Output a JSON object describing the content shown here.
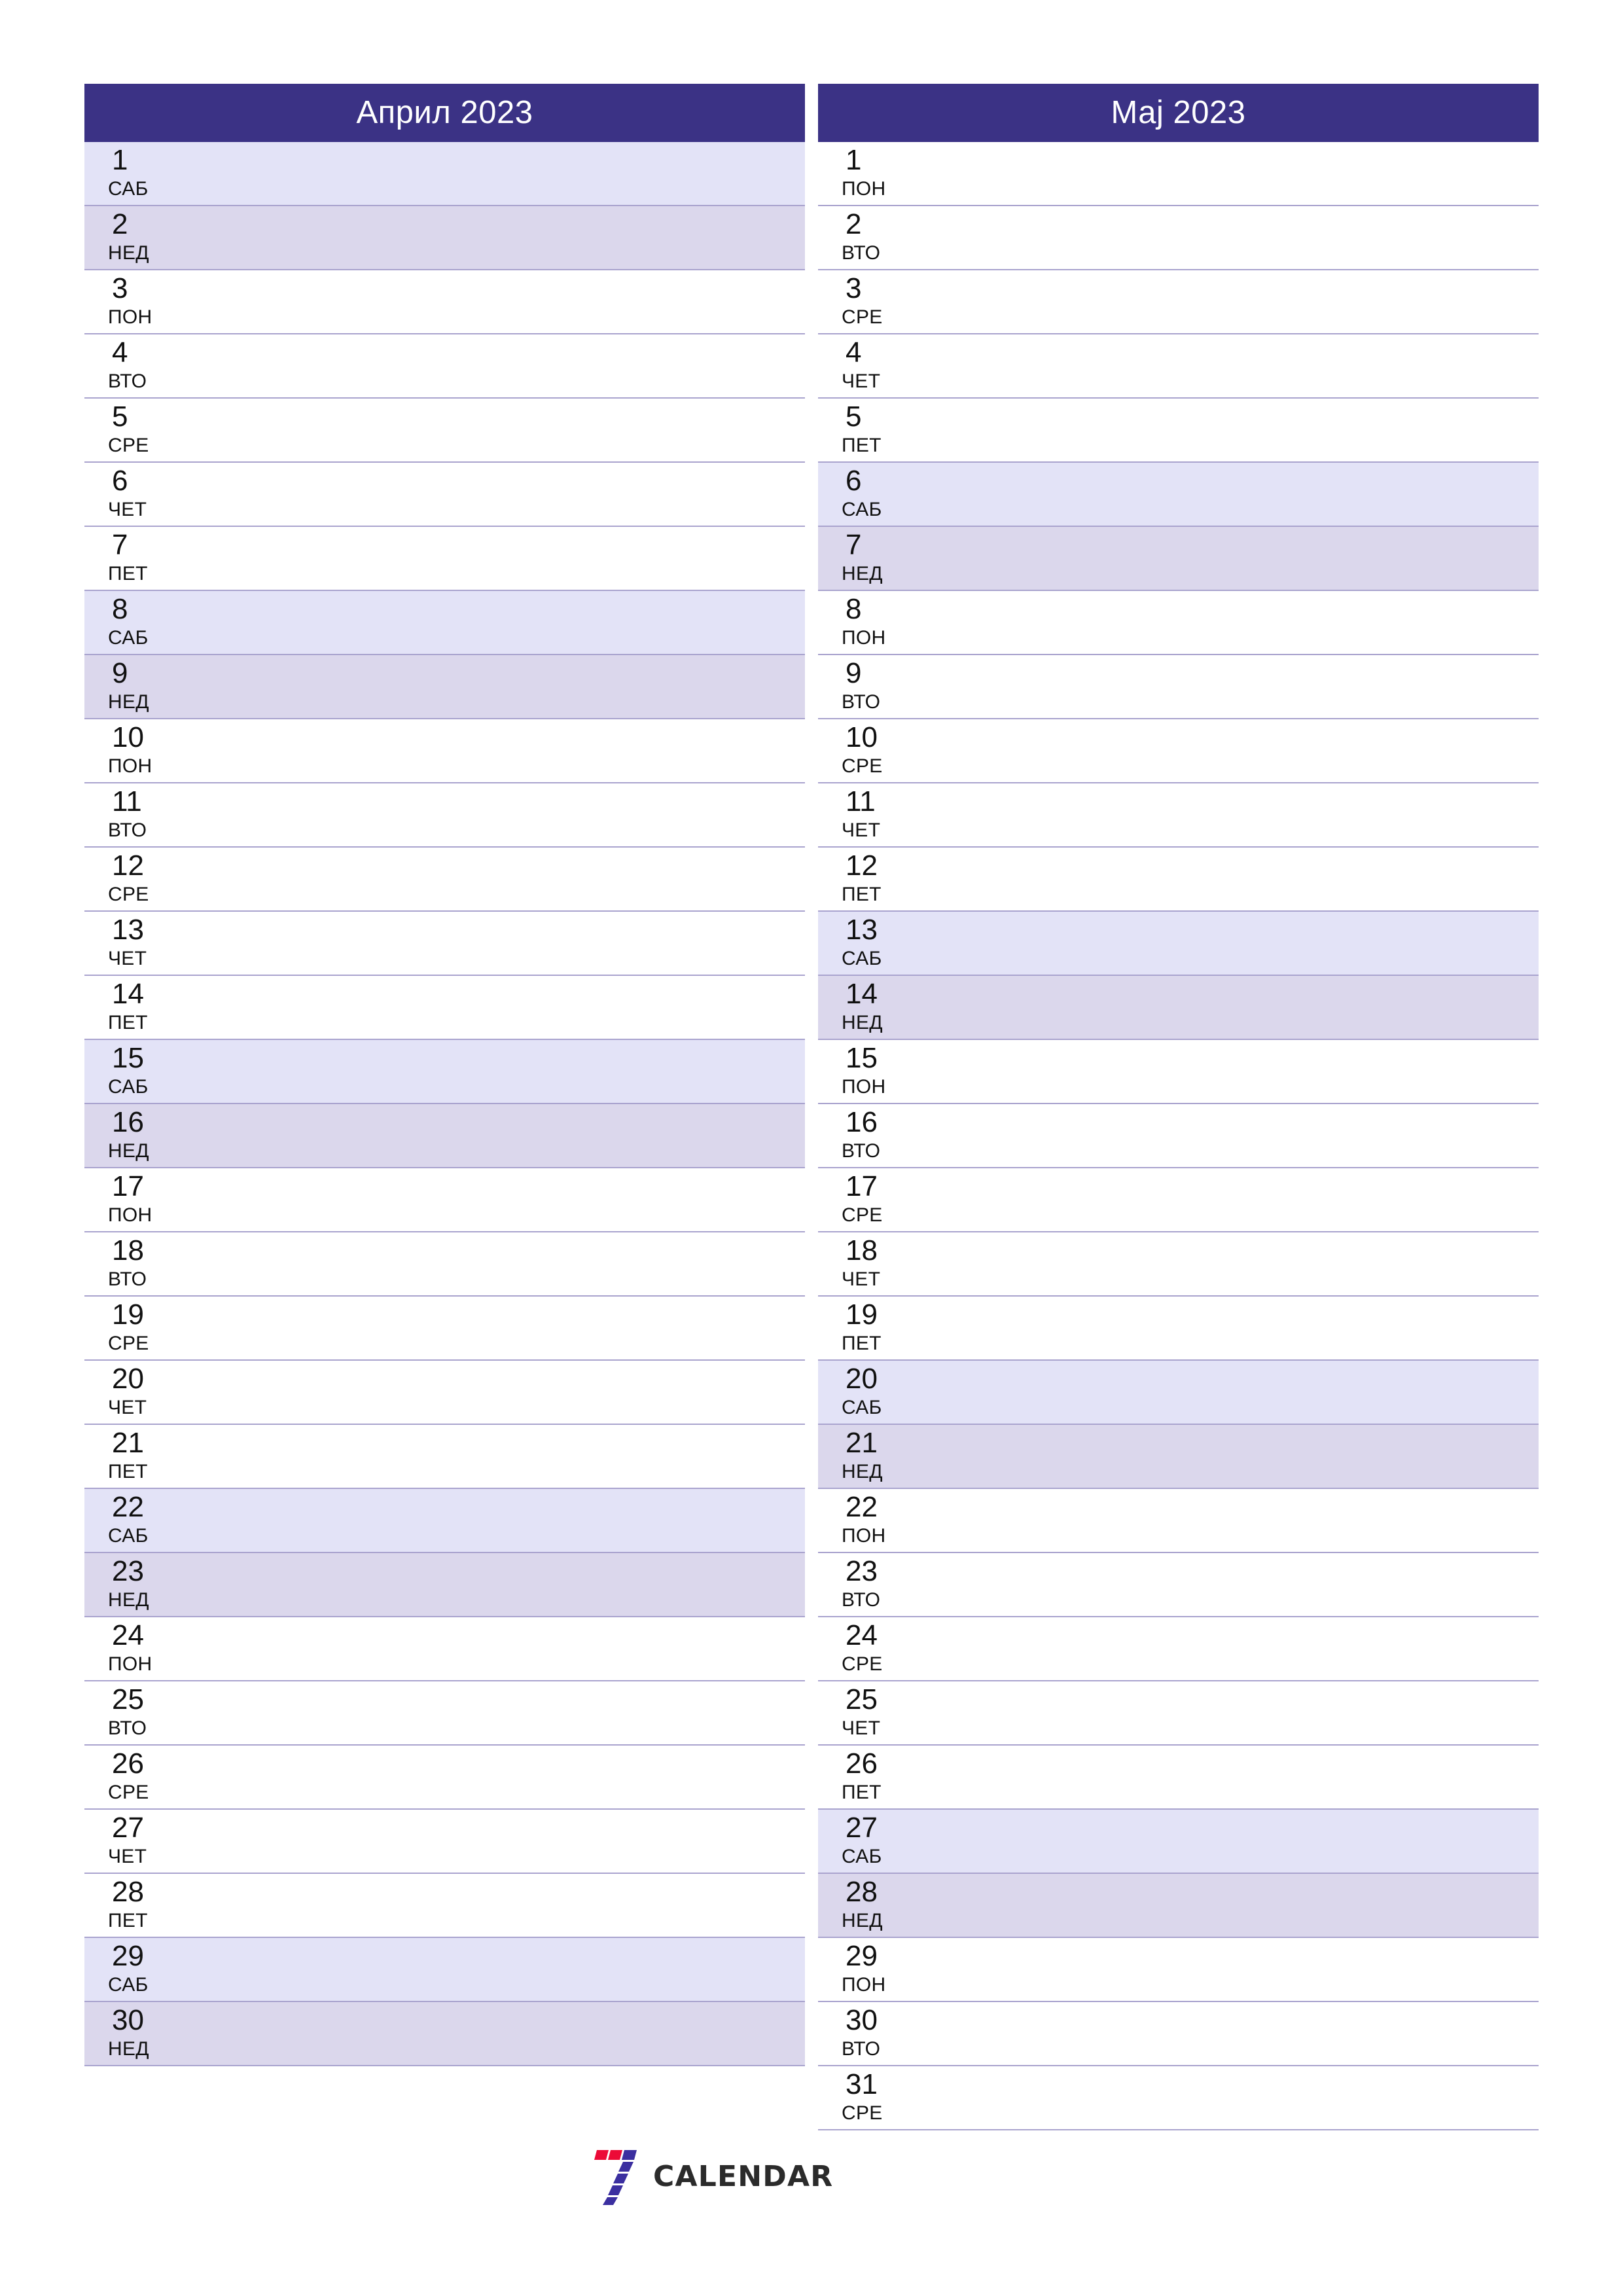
{
  "document": {
    "type": "two-month-planner",
    "orientation": "portrait"
  },
  "colors": {
    "header_bg": "#3b3285",
    "header_text": "#ffffff",
    "saturday_bg": "#e3e3f7",
    "sunday_bg": "#dbd7ec",
    "weekday_bg": "#ffffff",
    "row_divider": "#a9a3ce",
    "logo_red": "#ec0a37",
    "logo_blue": "#3b2fa0",
    "logo_text": "#2b2b2b"
  },
  "months": [
    {
      "title": "Април 2023",
      "name": "Април",
      "year": "2023",
      "days": [
        {
          "num": "1",
          "weekday": "САБ",
          "type": "sat"
        },
        {
          "num": "2",
          "weekday": "НЕД",
          "type": "sun"
        },
        {
          "num": "3",
          "weekday": "ПОН",
          "type": "weekday"
        },
        {
          "num": "4",
          "weekday": "ВТО",
          "type": "weekday"
        },
        {
          "num": "5",
          "weekday": "СРЕ",
          "type": "weekday"
        },
        {
          "num": "6",
          "weekday": "ЧЕТ",
          "type": "weekday"
        },
        {
          "num": "7",
          "weekday": "ПЕТ",
          "type": "weekday"
        },
        {
          "num": "8",
          "weekday": "САБ",
          "type": "sat"
        },
        {
          "num": "9",
          "weekday": "НЕД",
          "type": "sun"
        },
        {
          "num": "10",
          "weekday": "ПОН",
          "type": "weekday"
        },
        {
          "num": "11",
          "weekday": "ВТО",
          "type": "weekday"
        },
        {
          "num": "12",
          "weekday": "СРЕ",
          "type": "weekday"
        },
        {
          "num": "13",
          "weekday": "ЧЕТ",
          "type": "weekday"
        },
        {
          "num": "14",
          "weekday": "ПЕТ",
          "type": "weekday"
        },
        {
          "num": "15",
          "weekday": "САБ",
          "type": "sat"
        },
        {
          "num": "16",
          "weekday": "НЕД",
          "type": "sun"
        },
        {
          "num": "17",
          "weekday": "ПОН",
          "type": "weekday"
        },
        {
          "num": "18",
          "weekday": "ВТО",
          "type": "weekday"
        },
        {
          "num": "19",
          "weekday": "СРЕ",
          "type": "weekday"
        },
        {
          "num": "20",
          "weekday": "ЧЕТ",
          "type": "weekday"
        },
        {
          "num": "21",
          "weekday": "ПЕТ",
          "type": "weekday"
        },
        {
          "num": "22",
          "weekday": "САБ",
          "type": "sat"
        },
        {
          "num": "23",
          "weekday": "НЕД",
          "type": "sun"
        },
        {
          "num": "24",
          "weekday": "ПОН",
          "type": "weekday"
        },
        {
          "num": "25",
          "weekday": "ВТО",
          "type": "weekday"
        },
        {
          "num": "26",
          "weekday": "СРЕ",
          "type": "weekday"
        },
        {
          "num": "27",
          "weekday": "ЧЕТ",
          "type": "weekday"
        },
        {
          "num": "28",
          "weekday": "ПЕТ",
          "type": "weekday"
        },
        {
          "num": "29",
          "weekday": "САБ",
          "type": "sat"
        },
        {
          "num": "30",
          "weekday": "НЕД",
          "type": "sun"
        }
      ]
    },
    {
      "title": "Мај 2023",
      "name": "Мај",
      "year": "2023",
      "days": [
        {
          "num": "1",
          "weekday": "ПОН",
          "type": "weekday"
        },
        {
          "num": "2",
          "weekday": "ВТО",
          "type": "weekday"
        },
        {
          "num": "3",
          "weekday": "СРЕ",
          "type": "weekday"
        },
        {
          "num": "4",
          "weekday": "ЧЕТ",
          "type": "weekday"
        },
        {
          "num": "5",
          "weekday": "ПЕТ",
          "type": "weekday"
        },
        {
          "num": "6",
          "weekday": "САБ",
          "type": "sat"
        },
        {
          "num": "7",
          "weekday": "НЕД",
          "type": "sun"
        },
        {
          "num": "8",
          "weekday": "ПОН",
          "type": "weekday"
        },
        {
          "num": "9",
          "weekday": "ВТО",
          "type": "weekday"
        },
        {
          "num": "10",
          "weekday": "СРЕ",
          "type": "weekday"
        },
        {
          "num": "11",
          "weekday": "ЧЕТ",
          "type": "weekday"
        },
        {
          "num": "12",
          "weekday": "ПЕТ",
          "type": "weekday"
        },
        {
          "num": "13",
          "weekday": "САБ",
          "type": "sat"
        },
        {
          "num": "14",
          "weekday": "НЕД",
          "type": "sun"
        },
        {
          "num": "15",
          "weekday": "ПОН",
          "type": "weekday"
        },
        {
          "num": "16",
          "weekday": "ВТО",
          "type": "weekday"
        },
        {
          "num": "17",
          "weekday": "СРЕ",
          "type": "weekday"
        },
        {
          "num": "18",
          "weekday": "ЧЕТ",
          "type": "weekday"
        },
        {
          "num": "19",
          "weekday": "ПЕТ",
          "type": "weekday"
        },
        {
          "num": "20",
          "weekday": "САБ",
          "type": "sat"
        },
        {
          "num": "21",
          "weekday": "НЕД",
          "type": "sun"
        },
        {
          "num": "22",
          "weekday": "ПОН",
          "type": "weekday"
        },
        {
          "num": "23",
          "weekday": "ВТО",
          "type": "weekday"
        },
        {
          "num": "24",
          "weekday": "СРЕ",
          "type": "weekday"
        },
        {
          "num": "25",
          "weekday": "ЧЕТ",
          "type": "weekday"
        },
        {
          "num": "26",
          "weekday": "ПЕТ",
          "type": "weekday"
        },
        {
          "num": "27",
          "weekday": "САБ",
          "type": "sat"
        },
        {
          "num": "28",
          "weekday": "НЕД",
          "type": "sun"
        },
        {
          "num": "29",
          "weekday": "ПОН",
          "type": "weekday"
        },
        {
          "num": "30",
          "weekday": "ВТО",
          "type": "weekday"
        },
        {
          "num": "31",
          "weekday": "СРЕ",
          "type": "weekday"
        }
      ]
    }
  ],
  "brand": {
    "word": "CALENDAR",
    "mark": "seven-logo-icon"
  }
}
